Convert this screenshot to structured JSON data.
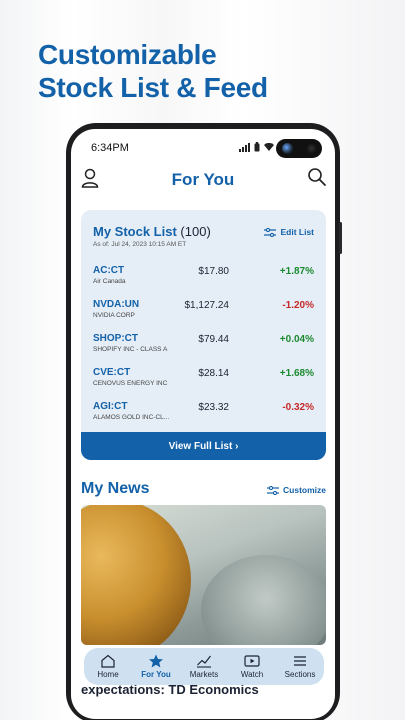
{
  "headline": {
    "line1": "Customizable",
    "line2": "Stock List & Feed"
  },
  "status_bar": {
    "time": "6:34PM"
  },
  "header": {
    "title": "For You"
  },
  "stock_list": {
    "title": "My Stock List",
    "count": "(100)",
    "as_of": "As of: Jul 24, 2023 10:15 AM ET",
    "edit_label": "Edit List",
    "rows": [
      {
        "symbol": "AC:CT",
        "name": "Air Canada",
        "price": "$17.80",
        "change": "+1.87%",
        "direction": "up"
      },
      {
        "symbol": "NVDA:UN",
        "name": "NVIDIA CORP",
        "price": "$1,127.24",
        "change": "-1.20%",
        "direction": "down"
      },
      {
        "symbol": "SHOP:CT",
        "name": "SHOPIFY INC - CLASS A",
        "price": "$79.44",
        "change": "+0.04%",
        "direction": "up"
      },
      {
        "symbol": "CVE:CT",
        "name": "CENOVUS ENERGY INC",
        "price": "$28.14",
        "change": "+1.68%",
        "direction": "up"
      },
      {
        "symbol": "AGI:CT",
        "name": "ALAMOS GOLD INC-CL...",
        "price": "$23.32",
        "change": "-0.32%",
        "direction": "down"
      }
    ],
    "view_full_label": "View Full List ›"
  },
  "news": {
    "title": "My News",
    "customize_label": "Customize",
    "headline": "expectations: TD Economics"
  },
  "bottom_nav": [
    {
      "label": "Home",
      "icon": "home-icon",
      "active": false
    },
    {
      "label": "For You",
      "icon": "star-icon",
      "active": true
    },
    {
      "label": "Markets",
      "icon": "chart-icon",
      "active": false
    },
    {
      "label": "Watch",
      "icon": "play-icon",
      "active": false
    },
    {
      "label": "Sections",
      "icon": "menu-icon",
      "active": false
    }
  ],
  "colors": {
    "brand": "#1361a8",
    "up": "#1b8a2f",
    "down": "#c62828",
    "card_bg": "#e5eef7"
  }
}
